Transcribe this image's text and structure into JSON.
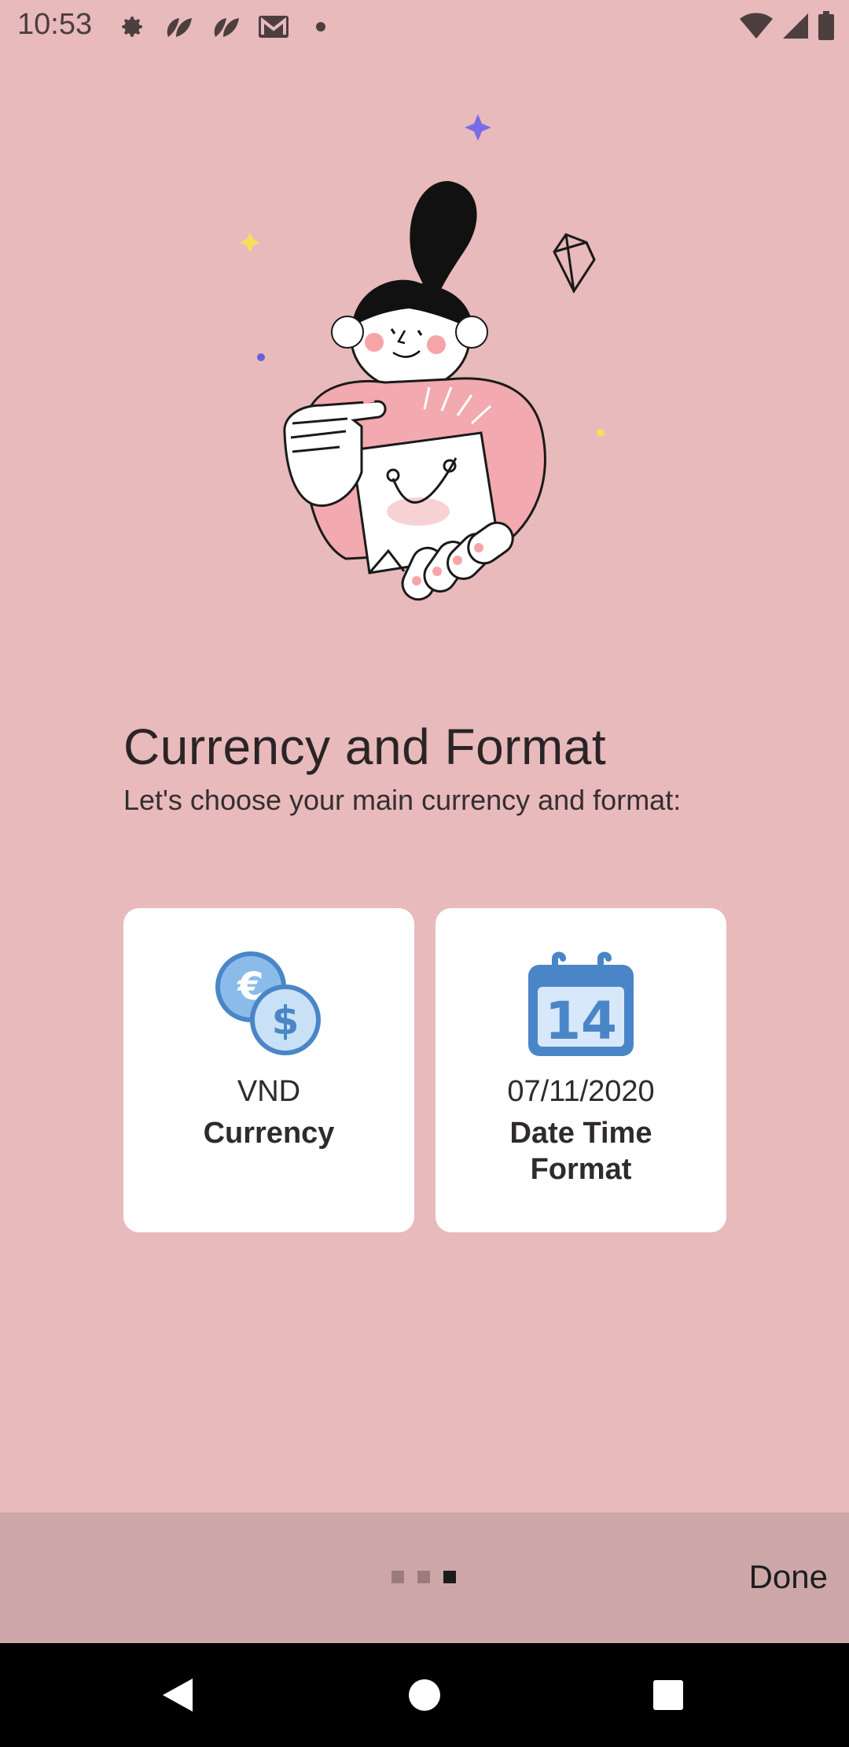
{
  "status_bar": {
    "time": "10:53",
    "left_icons": [
      "gear-icon",
      "leaf-icon",
      "leaf-icon",
      "gmail-icon",
      "dot-icon"
    ],
    "right_icons": [
      "wifi-icon",
      "signal-icon",
      "battery-icon"
    ]
  },
  "onboarding": {
    "illustration": "woman-holding-shopping-bag",
    "title": "Currency and Format",
    "subtitle": "Let's choose your main currency and format:",
    "cards": {
      "currency": {
        "icon": "currency-coins-icon",
        "value": "VND",
        "label": "Currency"
      },
      "datetime": {
        "icon": "calendar-icon",
        "value": "07/11/2020",
        "label": "Date Time Format",
        "calendar_day": "14"
      }
    }
  },
  "bottom_bar": {
    "page_count": 3,
    "current_page": 3,
    "done_label": "Done"
  },
  "colors": {
    "background": "#e8babb",
    "bottom_bar": "#cda7a8",
    "card": "#ffffff",
    "accent_blue": "#4a86c7"
  }
}
